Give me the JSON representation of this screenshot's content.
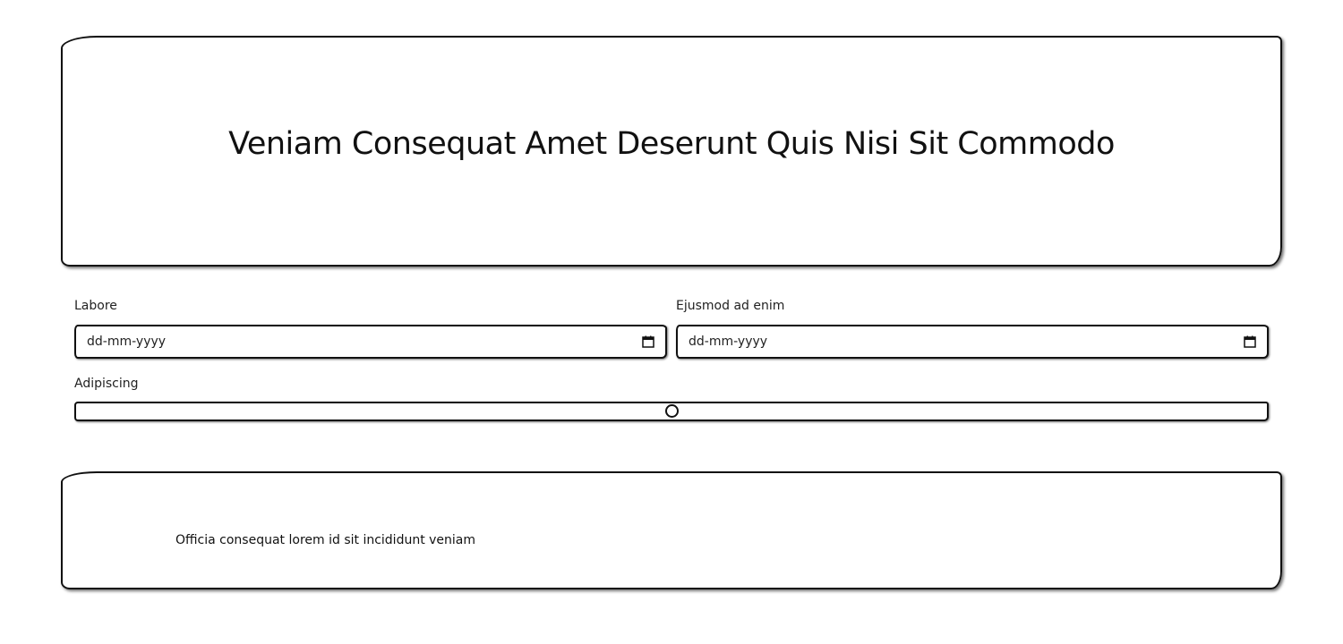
{
  "hero": {
    "title": "Veniam Consequat Amet Deserunt Quis Nisi Sit Commodo"
  },
  "form": {
    "field_1": {
      "label": "Labore",
      "placeholder": "dd-mm-yyyy"
    },
    "field_2": {
      "label": "Ejusmod ad enim",
      "placeholder": "dd-mm-yyyy"
    },
    "range": {
      "label": "Adipiscing",
      "value_fraction": 0.5
    }
  },
  "note": {
    "text": "Officia consequat lorem id sit incididunt veniam"
  },
  "icons": {
    "calendar": "calendar-icon"
  }
}
